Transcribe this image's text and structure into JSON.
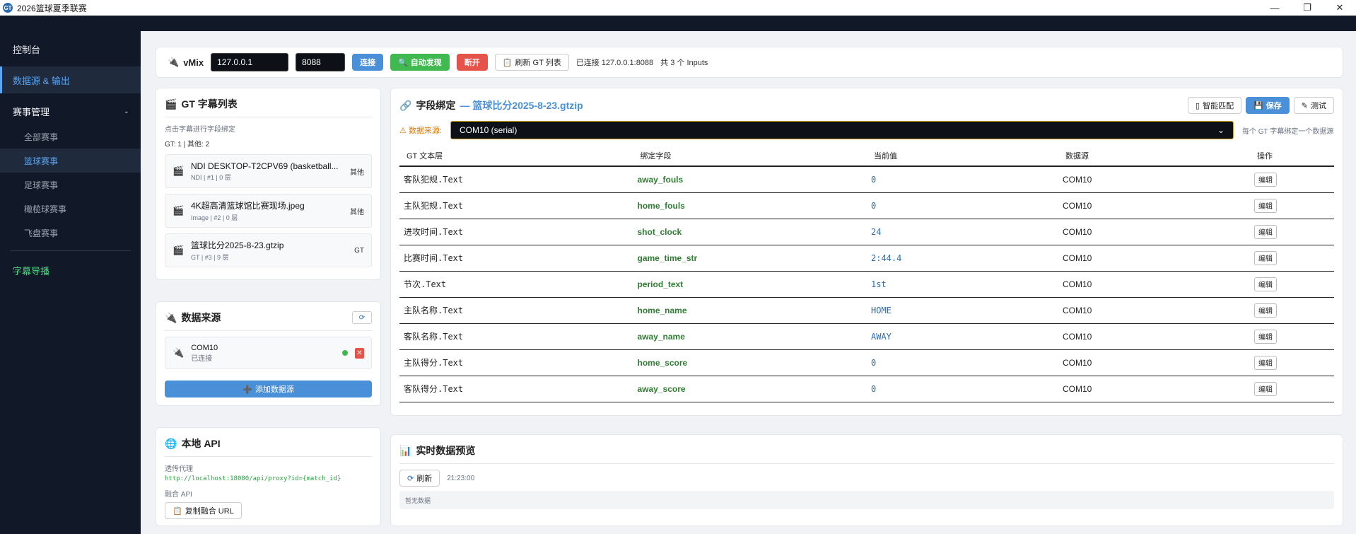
{
  "window": {
    "title": "2026篮球夏季联赛",
    "icon_text": "GT",
    "minimize": "—",
    "maximize": "❐",
    "close": "✕"
  },
  "sidebar": {
    "console": "控制台",
    "data_output": "数据源 & 输出",
    "events_group": "赛事管理",
    "events_toggle": "-",
    "sub_items": [
      "全部赛事",
      "篮球赛事",
      "足球赛事",
      "橄榄球赛事",
      "飞盘赛事"
    ],
    "broadcast": "字幕导播"
  },
  "vmix": {
    "label": "vMix",
    "host": "127.0.0.1",
    "port": "8088",
    "connect": "连接",
    "auto_discover": "自动发现",
    "disconnect": "断开",
    "refresh_gt": "刷新 GT 列表",
    "status": "已连接 127.0.0.1:8088",
    "inputs": "共 3 个 Inputs"
  },
  "gt_list": {
    "title": "GT 字幕列表",
    "hint": "点击字幕进行字段绑定",
    "counts": "GT: 1 | 其他: 2",
    "items": [
      {
        "name": "NDI DESKTOP-T2CPV69 (basketball...",
        "sub": "NDI | #1 | 0 层",
        "tag": "其他",
        "icon": "🎬"
      },
      {
        "name": "4K超高清篮球馆比赛现场.jpeg",
        "sub": "Image | #2 | 0 层",
        "tag": "其他",
        "icon": "🎬"
      },
      {
        "name": "篮球比分2025-8-23.gtzip",
        "sub": "GT | #3 | 9 层",
        "tag": "GT",
        "icon": "🎬"
      }
    ]
  },
  "datasource": {
    "title": "数据来源",
    "refresh_icon": "⟳",
    "item_name": "COM10",
    "item_status": "已连接",
    "delete": "✕",
    "add": "添加数据源"
  },
  "api": {
    "title": "本地 API",
    "proxy_label": "透传代理",
    "proxy_url": "http://localhost:18080/api/proxy?id={match_id}",
    "fusion_label": "融合 API",
    "copy_btn": "复制融合 URL"
  },
  "binding": {
    "title_prefix": "字段绑定",
    "title_file": "— 篮球比分2025-8-23.gtzip",
    "smart_match": "智能匹配",
    "save": "保存",
    "test": "测试",
    "source_label": "数据来源:",
    "source_value": "COM10 (serial)",
    "source_hint": "每个 GT 字幕绑定一个数据源",
    "headers": [
      "GT 文本层",
      "绑定字段",
      "当前值",
      "数据源",
      "操作"
    ],
    "rows": [
      {
        "layer": "客队犯规.Text",
        "field": "away_fouls",
        "value": "0",
        "source": "COM10",
        "action": "编辑"
      },
      {
        "layer": "主队犯规.Text",
        "field": "home_fouls",
        "value": "0",
        "source": "COM10",
        "action": "编辑"
      },
      {
        "layer": "进攻时间.Text",
        "field": "shot_clock",
        "value": "24",
        "source": "COM10",
        "action": "编辑"
      },
      {
        "layer": "比赛时间.Text",
        "field": "game_time_str",
        "value": "2:44.4",
        "source": "COM10",
        "action": "编辑"
      },
      {
        "layer": "节次.Text",
        "field": "period_text",
        "value": "1st",
        "source": "COM10",
        "action": "编辑"
      },
      {
        "layer": "主队名称.Text",
        "field": "home_name",
        "value": "HOME",
        "source": "COM10",
        "action": "编辑"
      },
      {
        "layer": "客队名称.Text",
        "field": "away_name",
        "value": "AWAY",
        "source": "COM10",
        "action": "编辑"
      },
      {
        "layer": "主队得分.Text",
        "field": "home_score",
        "value": "0",
        "source": "COM10",
        "action": "编辑"
      },
      {
        "layer": "客队得分.Text",
        "field": "away_score",
        "value": "0",
        "source": "COM10",
        "action": "编辑"
      }
    ]
  },
  "preview": {
    "title": "实时数据预览",
    "refresh": "刷新",
    "time": "21:23:00",
    "empty": "暂无数据"
  }
}
